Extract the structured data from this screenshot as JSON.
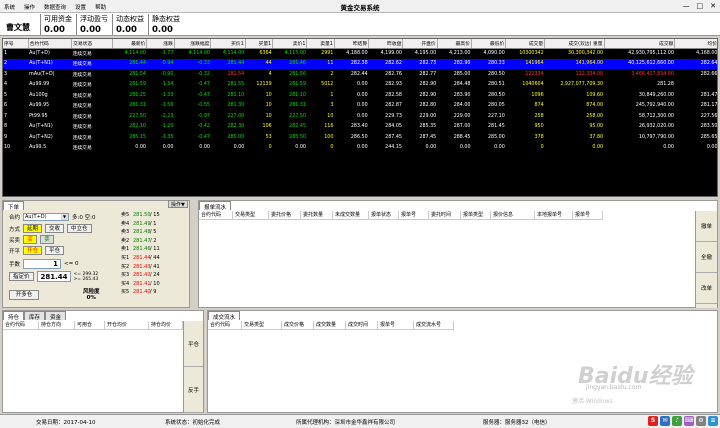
{
  "menu": [
    "系统",
    "操作",
    "数据查询",
    "设置",
    "帮助"
  ],
  "app_title": "黄金交易系统",
  "window_buttons": [
    "—",
    "□",
    "✕"
  ],
  "user": "曹文慧",
  "stats": [
    {
      "label": "可用资金",
      "value": "0.00"
    },
    {
      "label": "浮动盈亏",
      "value": "0.00"
    },
    {
      "label": "动态权益",
      "value": "0.00"
    },
    {
      "label": "静态权益",
      "value": "0.00"
    }
  ],
  "quote_headers": [
    "序号",
    "合约代码",
    "交易状态",
    "最新价",
    "涨跌",
    "涨跌幅度",
    "买价1",
    "买量1",
    "卖价1",
    "卖量1",
    "昨结算",
    "昨收盘",
    "开盘价",
    "最高价",
    "最低价",
    "成交量",
    "成交(双边) 重量",
    "成交额",
    "均价"
  ],
  "quotes": [
    [
      "1",
      "Au(T+D)",
      "连续交易",
      "4,114.00",
      "-1.77",
      "4,114.00",
      "4,114.00",
      "6364",
      "4,115.00",
      "2991",
      "4,188.00",
      "4,199.00",
      "4,195.00",
      "4,213.00",
      "4,090.00",
      "10300342",
      "30,300,342.00",
      "42,930,795,112.00",
      "4,168.00"
    ],
    [
      "2",
      "Au(T+N1)",
      "连续交易",
      "281.44",
      "-0.94",
      "-0.33",
      "281.44",
      "44",
      "281.46",
      "11",
      "282.38",
      "282.62",
      "282.73",
      "282.90",
      "280.33",
      "141964",
      "141,964.00",
      "40,125,612,660.00",
      "282.64"
    ],
    [
      "3",
      "mAu(T+D)",
      "连续交易",
      "281.54",
      "-0.90",
      "-0.32",
      "281.54",
      "4",
      "281.56",
      "2",
      "282.44",
      "282.76",
      "282.77",
      "285.00",
      "280.50",
      "122334",
      "122,334.00",
      "3,466,417,834.00",
      "282.66"
    ],
    [
      "4",
      "Au99.99",
      "连续交易",
      "281.59",
      "-1.34",
      "-0.47",
      "281.55",
      "12139",
      "281.59",
      "5012",
      "0.00",
      "282.93",
      "282.90",
      "284.48",
      "280.51",
      "1040604",
      "2,927,077,709.30",
      "281.28"
    ],
    [
      "5",
      "Au100g",
      "连续交易",
      "281.25",
      "-1.33",
      "-0.47",
      "281.10",
      "10",
      "281.10",
      "1",
      "0.00",
      "282.58",
      "282.90",
      "283.90",
      "280.50",
      "1096",
      "109.60",
      "30,849,260.00",
      "281.47"
    ],
    [
      "6",
      "Au99.95",
      "连续交易",
      "281.31",
      "-1.56",
      "-0.55",
      "281.30",
      "10",
      "281.31",
      "3",
      "0.00",
      "282.87",
      "282.80",
      "284.00",
      "280.05",
      "874",
      "874.00",
      "245,792,940.00",
      "281.17"
    ],
    [
      "7",
      "Pt99.95",
      "连续交易",
      "227.50",
      "-2.23",
      "-0.97",
      "227.00",
      "10",
      "227.50",
      "10",
      "0.00",
      "229.73",
      "229.00",
      "229.00",
      "227.10",
      "258",
      "258.00",
      "58,712,300.00",
      "227.56"
    ],
    [
      "8",
      "Au(T+N1)",
      "连续交易",
      "282.10",
      "-1.20",
      "-0.42",
      "282.30",
      "106",
      "282.45",
      "116",
      "283.40",
      "284.05",
      "285.35",
      "287.00",
      "281.45",
      "950",
      "95.00",
      "26,932,020.00",
      "283.50"
    ],
    [
      "9",
      "Au(T+N2)",
      "连续交易",
      "285.15",
      "-1.35",
      "-0.47",
      "285.00",
      "53",
      "285.50",
      "100",
      "286.50",
      "287.45",
      "287.45",
      "288.45",
      "285.00",
      "378",
      "37.80",
      "10,797,790.00",
      "285.65"
    ],
    [
      "10",
      "Au99.5",
      "连续交易",
      "0.00",
      "0.00",
      "0.00",
      "0.00",
      "0",
      "0.00",
      "0",
      "0.00",
      "244.15",
      "0.00",
      "0.00",
      "0.00",
      "0",
      "0.00",
      "0.00",
      "0.00"
    ]
  ],
  "order": {
    "tab": "下单",
    "options_button": "操作▼",
    "contract_label": "合约",
    "contract_value": "Au(T+D)",
    "more_label": "多:0 空:0",
    "method_label": "方式",
    "method_options": [
      "延期",
      "交收",
      "中立仓"
    ],
    "buysell_label": "买卖",
    "buy": "买",
    "sell": "卖",
    "openclose_label": "开平",
    "open": "开仓",
    "close": "平仓",
    "qty_label": "手数",
    "qty_value": "1",
    "qty_hint": "<= 0",
    "price_button": "指定价",
    "price_value": "281.44",
    "price_hint1": "<= 299.32",
    "price_hint2": ">= 265.43",
    "submit": "开多仓",
    "risk_label1": "风险度",
    "risk_label2": "0%",
    "depth": [
      {
        "lv": "卖5",
        "price": "281.50",
        "vol": "/ 15",
        "color": "#008000"
      },
      {
        "lv": "卖4",
        "price": "281.49",
        "vol": "/ 1",
        "color": "#008000"
      },
      {
        "lv": "卖3",
        "price": "281.48",
        "vol": "/ 5",
        "color": "#008000"
      },
      {
        "lv": "卖2",
        "price": "281.47",
        "vol": "/ 2",
        "color": "#008000"
      },
      {
        "lv": "卖1",
        "price": "281.46",
        "vol": "/ 11",
        "color": "#008000"
      },
      {
        "lv": "买1",
        "price": "281.44",
        "vol": "/ 44",
        "color": "#ff0000"
      },
      {
        "lv": "买2",
        "price": "281.43",
        "vol": "/ 41",
        "color": "#ff0000"
      },
      {
        "lv": "买3",
        "price": "281.42",
        "vol": "/ 24",
        "color": "#ff0000"
      },
      {
        "lv": "买4",
        "price": "281.41",
        "vol": "/ 10",
        "color": "#ff0000"
      },
      {
        "lv": "买5",
        "price": "281.40",
        "vol": "/ 9",
        "color": "#ff0000"
      }
    ]
  },
  "pending": {
    "tab": "报单流水",
    "headers": [
      "合约代码",
      "交易类型",
      "委托价格",
      "委托数量",
      "未成交数量",
      "报单状态",
      "报单号",
      "委托时间",
      "报单类型",
      "报价信息",
      "本地报单号",
      "报单号"
    ],
    "side_buttons": [
      "撤单",
      "全撤",
      "改单"
    ]
  },
  "positions": {
    "tabs": [
      "持仓",
      "库存",
      "资金"
    ],
    "headers": [
      "合约代码",
      "持仓方向",
      "可用仓",
      "开仓均价",
      "持仓均价"
    ],
    "side_buttons": [
      "平仓",
      "反手"
    ]
  },
  "trades": {
    "tab": "成交流水",
    "headers": [
      "合约代码",
      "交易类型",
      "成交价格",
      "成交数量",
      "成交时间",
      "报单号",
      "成交流水号"
    ]
  },
  "statusbar": {
    "date": "交易日期：2017-04-10",
    "sys": "系统状态：初始化完成",
    "broker": "所属代理机构：深圳市金华鑫祥有限公司",
    "server": "服务器：服务器32（电信）"
  },
  "watermark": {
    "main": "Baidu经验",
    "sub": "jingyan.baidu.com",
    "activation": "激活 Windows"
  }
}
